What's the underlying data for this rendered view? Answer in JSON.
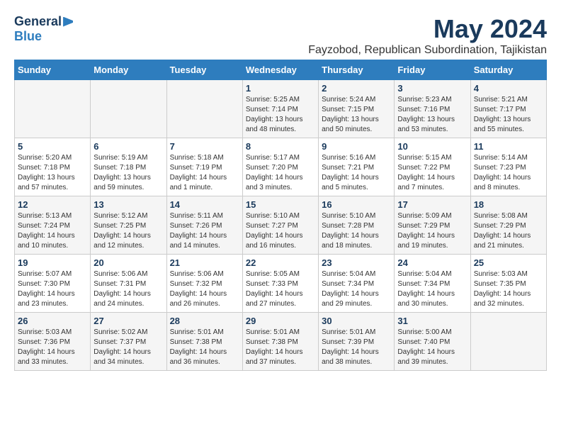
{
  "logo": {
    "general": "General",
    "blue": "Blue"
  },
  "title": "May 2024",
  "subtitle": "Fayzobod, Republican Subordination, Tajikistan",
  "days_of_week": [
    "Sunday",
    "Monday",
    "Tuesday",
    "Wednesday",
    "Thursday",
    "Friday",
    "Saturday"
  ],
  "weeks": [
    [
      {
        "day": "",
        "info": ""
      },
      {
        "day": "",
        "info": ""
      },
      {
        "day": "",
        "info": ""
      },
      {
        "day": "1",
        "info": "Sunrise: 5:25 AM\nSunset: 7:14 PM\nDaylight: 13 hours\nand 48 minutes."
      },
      {
        "day": "2",
        "info": "Sunrise: 5:24 AM\nSunset: 7:15 PM\nDaylight: 13 hours\nand 50 minutes."
      },
      {
        "day": "3",
        "info": "Sunrise: 5:23 AM\nSunset: 7:16 PM\nDaylight: 13 hours\nand 53 minutes."
      },
      {
        "day": "4",
        "info": "Sunrise: 5:21 AM\nSunset: 7:17 PM\nDaylight: 13 hours\nand 55 minutes."
      }
    ],
    [
      {
        "day": "5",
        "info": "Sunrise: 5:20 AM\nSunset: 7:18 PM\nDaylight: 13 hours\nand 57 minutes."
      },
      {
        "day": "6",
        "info": "Sunrise: 5:19 AM\nSunset: 7:18 PM\nDaylight: 13 hours\nand 59 minutes."
      },
      {
        "day": "7",
        "info": "Sunrise: 5:18 AM\nSunset: 7:19 PM\nDaylight: 14 hours\nand 1 minute."
      },
      {
        "day": "8",
        "info": "Sunrise: 5:17 AM\nSunset: 7:20 PM\nDaylight: 14 hours\nand 3 minutes."
      },
      {
        "day": "9",
        "info": "Sunrise: 5:16 AM\nSunset: 7:21 PM\nDaylight: 14 hours\nand 5 minutes."
      },
      {
        "day": "10",
        "info": "Sunrise: 5:15 AM\nSunset: 7:22 PM\nDaylight: 14 hours\nand 7 minutes."
      },
      {
        "day": "11",
        "info": "Sunrise: 5:14 AM\nSunset: 7:23 PM\nDaylight: 14 hours\nand 8 minutes."
      }
    ],
    [
      {
        "day": "12",
        "info": "Sunrise: 5:13 AM\nSunset: 7:24 PM\nDaylight: 14 hours\nand 10 minutes."
      },
      {
        "day": "13",
        "info": "Sunrise: 5:12 AM\nSunset: 7:25 PM\nDaylight: 14 hours\nand 12 minutes."
      },
      {
        "day": "14",
        "info": "Sunrise: 5:11 AM\nSunset: 7:26 PM\nDaylight: 14 hours\nand 14 minutes."
      },
      {
        "day": "15",
        "info": "Sunrise: 5:10 AM\nSunset: 7:27 PM\nDaylight: 14 hours\nand 16 minutes."
      },
      {
        "day": "16",
        "info": "Sunrise: 5:10 AM\nSunset: 7:28 PM\nDaylight: 14 hours\nand 18 minutes."
      },
      {
        "day": "17",
        "info": "Sunrise: 5:09 AM\nSunset: 7:29 PM\nDaylight: 14 hours\nand 19 minutes."
      },
      {
        "day": "18",
        "info": "Sunrise: 5:08 AM\nSunset: 7:29 PM\nDaylight: 14 hours\nand 21 minutes."
      }
    ],
    [
      {
        "day": "19",
        "info": "Sunrise: 5:07 AM\nSunset: 7:30 PM\nDaylight: 14 hours\nand 23 minutes."
      },
      {
        "day": "20",
        "info": "Sunrise: 5:06 AM\nSunset: 7:31 PM\nDaylight: 14 hours\nand 24 minutes."
      },
      {
        "day": "21",
        "info": "Sunrise: 5:06 AM\nSunset: 7:32 PM\nDaylight: 14 hours\nand 26 minutes."
      },
      {
        "day": "22",
        "info": "Sunrise: 5:05 AM\nSunset: 7:33 PM\nDaylight: 14 hours\nand 27 minutes."
      },
      {
        "day": "23",
        "info": "Sunrise: 5:04 AM\nSunset: 7:34 PM\nDaylight: 14 hours\nand 29 minutes."
      },
      {
        "day": "24",
        "info": "Sunrise: 5:04 AM\nSunset: 7:34 PM\nDaylight: 14 hours\nand 30 minutes."
      },
      {
        "day": "25",
        "info": "Sunrise: 5:03 AM\nSunset: 7:35 PM\nDaylight: 14 hours\nand 32 minutes."
      }
    ],
    [
      {
        "day": "26",
        "info": "Sunrise: 5:03 AM\nSunset: 7:36 PM\nDaylight: 14 hours\nand 33 minutes."
      },
      {
        "day": "27",
        "info": "Sunrise: 5:02 AM\nSunset: 7:37 PM\nDaylight: 14 hours\nand 34 minutes."
      },
      {
        "day": "28",
        "info": "Sunrise: 5:01 AM\nSunset: 7:38 PM\nDaylight: 14 hours\nand 36 minutes."
      },
      {
        "day": "29",
        "info": "Sunrise: 5:01 AM\nSunset: 7:38 PM\nDaylight: 14 hours\nand 37 minutes."
      },
      {
        "day": "30",
        "info": "Sunrise: 5:01 AM\nSunset: 7:39 PM\nDaylight: 14 hours\nand 38 minutes."
      },
      {
        "day": "31",
        "info": "Sunrise: 5:00 AM\nSunset: 7:40 PM\nDaylight: 14 hours\nand 39 minutes."
      },
      {
        "day": "",
        "info": ""
      }
    ]
  ]
}
